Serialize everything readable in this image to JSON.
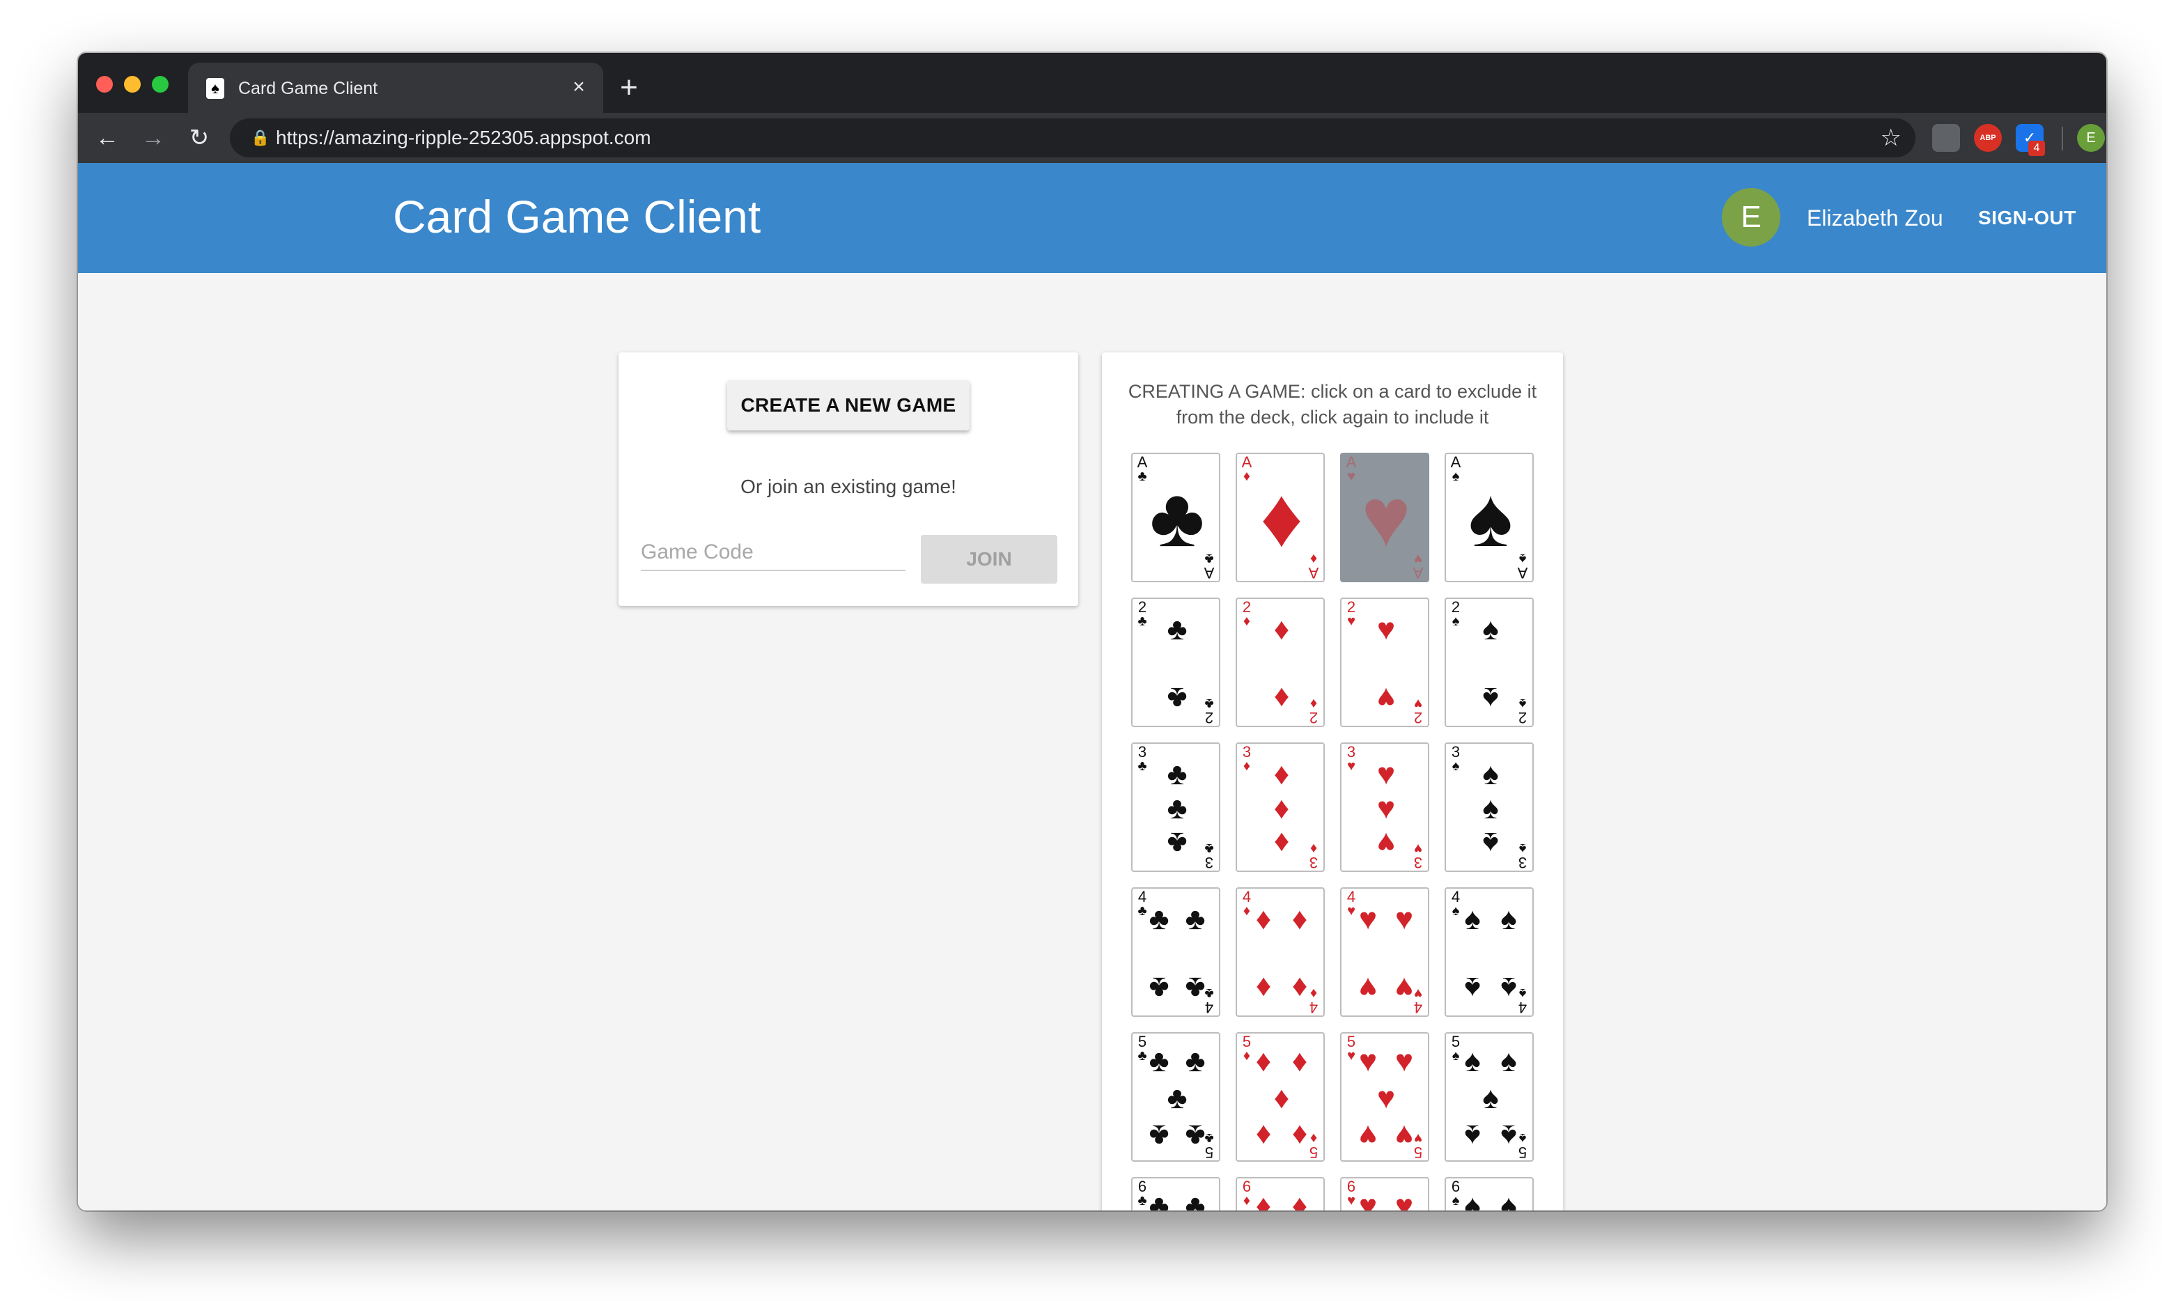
{
  "browser": {
    "tab_title": "Card Game Client",
    "tab_favicon": "♠",
    "close_glyph": "×",
    "new_tab_glyph": "+",
    "url": "https://amazing-ripple-252305.appspot.com",
    "extensions": {
      "abp_label": "ABP",
      "badge_count": "4",
      "profile_initial": "E"
    }
  },
  "app": {
    "title": "Card Game Client",
    "avatar_initial": "E",
    "user_name": "Elizabeth Zou",
    "signout_label": "SIGN-OUT",
    "colors": {
      "appbar": "#3a87cb",
      "avatar": "#7ca248",
      "red_suit": "#d2232a",
      "excluded_card": "#8e959c"
    }
  },
  "join_panel": {
    "create_label": "CREATE A NEW GAME",
    "or_join_text": "Or join an existing game!",
    "code_placeholder": "Game Code",
    "code_value": "",
    "join_label": "JOIN"
  },
  "deck_panel": {
    "instructions": "CREATING A GAME: click on a card to exclude it from the deck, click again to include it",
    "suits": [
      {
        "name": "clubs",
        "symbol": "♣",
        "color": "black"
      },
      {
        "name": "diamonds",
        "symbol": "♦",
        "color": "red"
      },
      {
        "name": "hearts",
        "symbol": "♥",
        "color": "red"
      },
      {
        "name": "spades",
        "symbol": "♠",
        "color": "black"
      }
    ],
    "ranks": [
      "A",
      "2",
      "3",
      "4",
      "5",
      "6"
    ],
    "excluded": [
      "A-hearts"
    ]
  }
}
